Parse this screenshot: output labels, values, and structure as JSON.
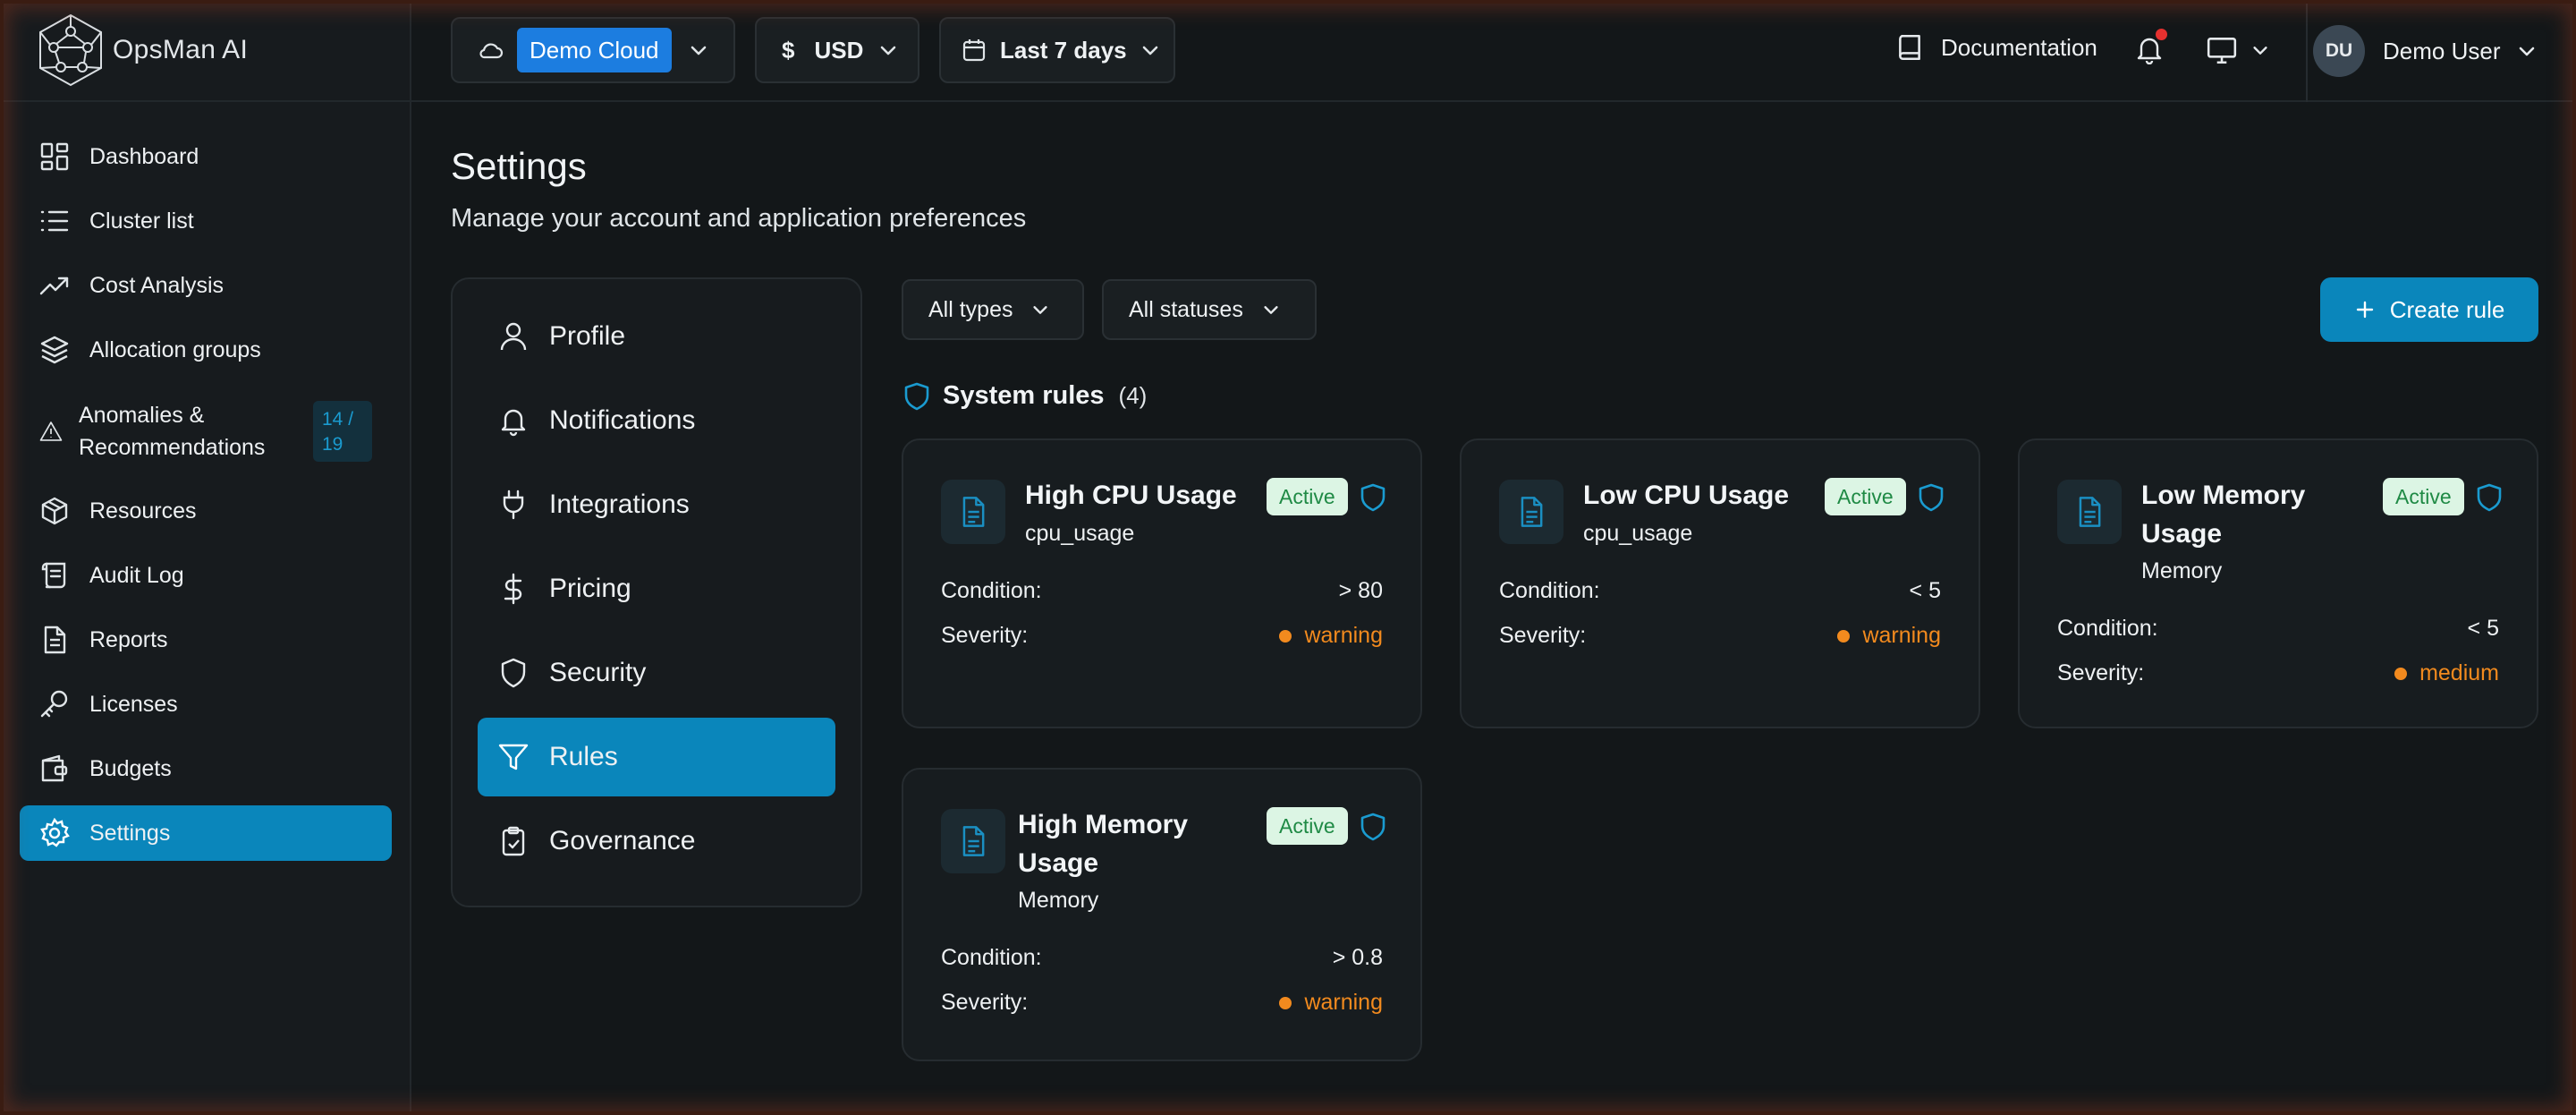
{
  "brand": {
    "name": "OpsMan AI"
  },
  "sidebar": {
    "items": [
      {
        "label": "Dashboard",
        "icon": "dashboard-icon"
      },
      {
        "label": "Cluster list",
        "icon": "list-icon"
      },
      {
        "label": "Cost Analysis",
        "icon": "trend-icon"
      },
      {
        "label": "Allocation groups",
        "icon": "layers-icon"
      },
      {
        "label": "Anomalies & Recommendations",
        "icon": "warning-icon",
        "badge": "14 / 19"
      },
      {
        "label": "Resources",
        "icon": "package-icon"
      },
      {
        "label": "Audit Log",
        "icon": "scroll-icon"
      },
      {
        "label": "Reports",
        "icon": "file-icon"
      },
      {
        "label": "Licenses",
        "icon": "key-icon"
      },
      {
        "label": "Budgets",
        "icon": "wallet-icon"
      },
      {
        "label": "Settings",
        "icon": "gear-icon",
        "active": true
      }
    ]
  },
  "topbar": {
    "cloud": "Demo Cloud",
    "currency": "USD",
    "currency_symbol": "$",
    "range": "Last 7 days",
    "docs": "Documentation",
    "user_initials": "DU",
    "user_name": "Demo User"
  },
  "page": {
    "title": "Settings",
    "subtitle": "Manage your account and application preferences"
  },
  "settings_nav": [
    {
      "label": "Profile",
      "icon": "user-icon"
    },
    {
      "label": "Notifications",
      "icon": "bell-icon"
    },
    {
      "label": "Integrations",
      "icon": "plug-icon"
    },
    {
      "label": "Pricing",
      "icon": "dollar-icon"
    },
    {
      "label": "Security",
      "icon": "shield-icon"
    },
    {
      "label": "Rules",
      "icon": "filter-icon",
      "active": true
    },
    {
      "label": "Governance",
      "icon": "clipboard-check-icon"
    }
  ],
  "filters": {
    "type": "All types",
    "status": "All statuses"
  },
  "create_rule": "Create rule",
  "system_rules": {
    "title": "System rules",
    "count": "(4)",
    "condition_label": "Condition:",
    "severity_label": "Severity:",
    "rules": [
      {
        "title": "High CPU Usage",
        "metric": "cpu_usage",
        "status": "Active",
        "condition": "> 80",
        "severity": "warning"
      },
      {
        "title": "Low CPU Usage",
        "metric": "cpu_usage",
        "status": "Active",
        "condition": "< 5",
        "severity": "warning"
      },
      {
        "title": "Low Memory Usage",
        "metric": "Memory",
        "status": "Active",
        "condition": "< 5",
        "severity": "medium"
      },
      {
        "title": "High Memory Usage",
        "metric": "Memory",
        "status": "Active",
        "condition": "> 0.8",
        "severity": "warning"
      }
    ]
  },
  "colors": {
    "accent": "#0a86bb",
    "warning": "#f28a1e",
    "active_badge_bg": "#dcf5e4",
    "active_badge_text": "#1f8a45"
  }
}
